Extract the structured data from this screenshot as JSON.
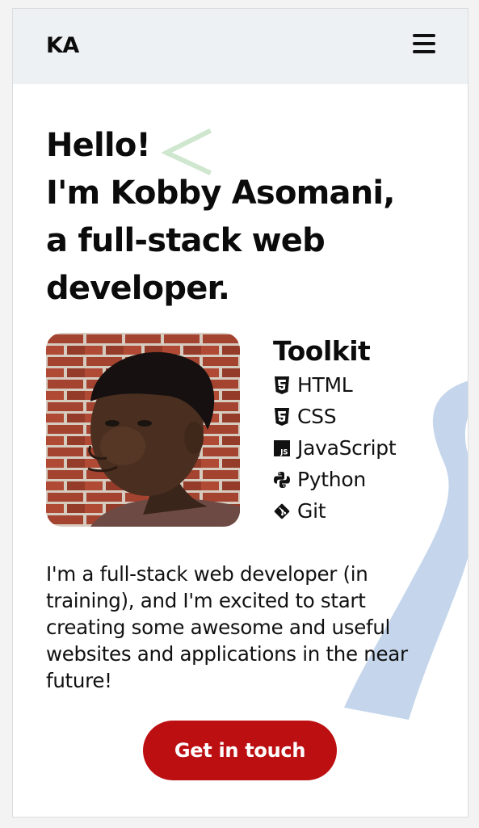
{
  "header": {
    "logo": "KA",
    "menu_icon": "hamburger-menu-icon"
  },
  "hero": {
    "title_lines": [
      "Hello!",
      "I'm Kobby Asomani,",
      "a full-stack web",
      "developer."
    ]
  },
  "toolkit": {
    "title": "Toolkit",
    "items": [
      {
        "label": "HTML",
        "icon": "html5-icon"
      },
      {
        "label": "CSS",
        "icon": "css3-icon"
      },
      {
        "label": "JavaScript",
        "icon": "javascript-icon"
      },
      {
        "label": "Python",
        "icon": "python-icon"
      },
      {
        "label": "Git",
        "icon": "git-icon"
      }
    ]
  },
  "bio": "I'm a full-stack web developer (in training), and I'm excited to start creating some awesome and useful websites and applications in the near future!",
  "cta": {
    "label": "Get in touch"
  },
  "colors": {
    "navbar_bg": "#edf1f4",
    "cta_bg": "#bc0f12",
    "deco_green": "#cfe6cf",
    "deco_blue": "#c5d6ec"
  }
}
